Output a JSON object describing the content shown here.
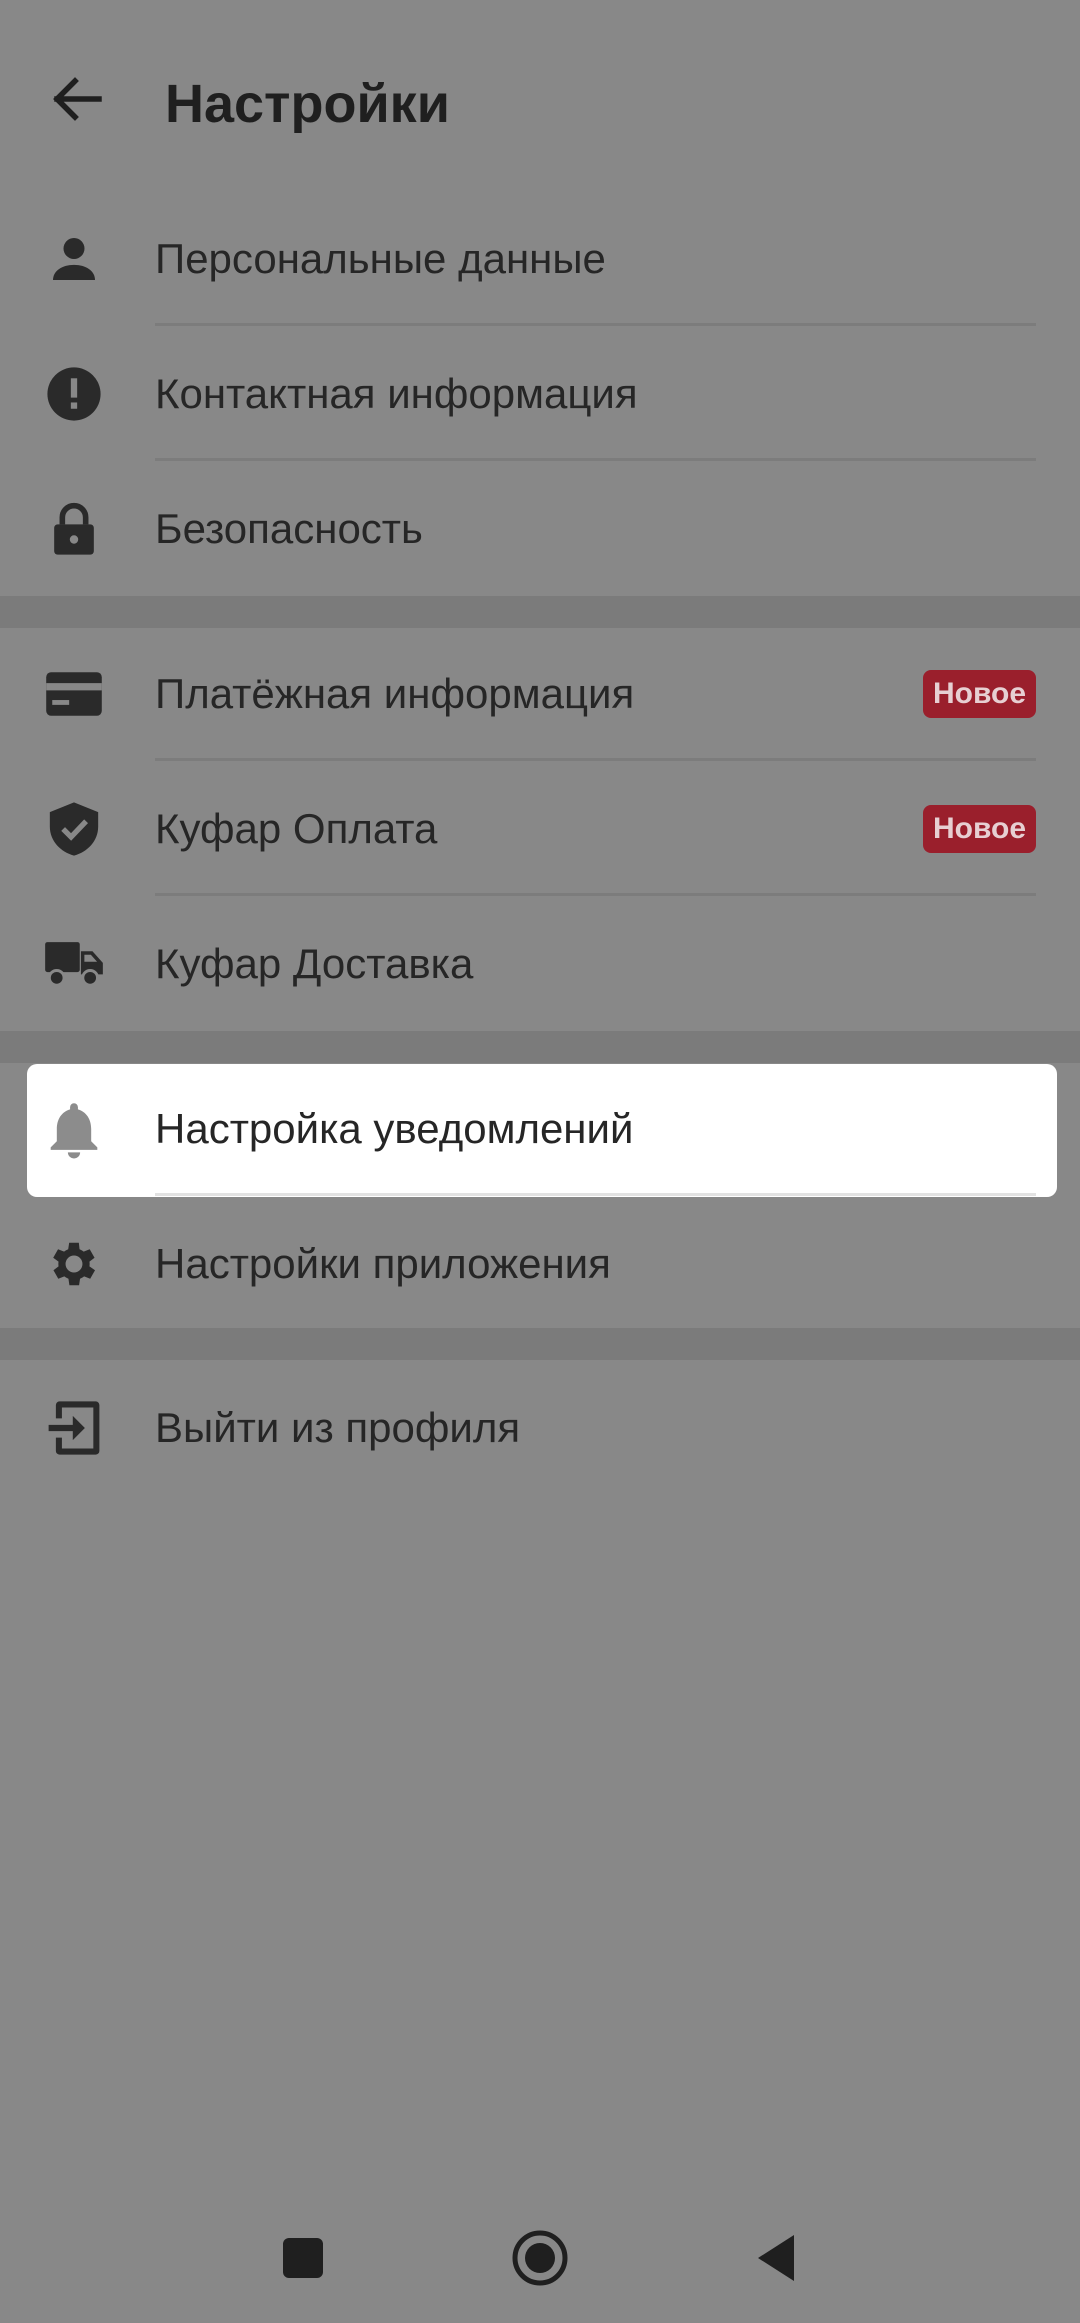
{
  "header": {
    "title": "Настройки",
    "back_icon": "arrow-left-icon"
  },
  "groups": [
    {
      "items": [
        {
          "label": "Персональные данные",
          "icon": "person-icon"
        },
        {
          "label": "Контактная информация",
          "icon": "exclamation-circle-icon"
        },
        {
          "label": "Безопасность",
          "icon": "lock-icon"
        }
      ]
    },
    {
      "items": [
        {
          "label": "Платёжная информация",
          "icon": "credit-card-icon",
          "badge": "Новое"
        },
        {
          "label": "Куфар Оплата",
          "icon": "shield-check-icon",
          "badge": "Новое"
        },
        {
          "label": "Куфар Доставка",
          "icon": "truck-icon"
        }
      ]
    },
    {
      "items": [
        {
          "label": "Настройка уведомлений",
          "icon": "bell-icon",
          "highlighted": true
        },
        {
          "label": "Настройки приложения",
          "icon": "gear-icon"
        }
      ]
    },
    {
      "items": [
        {
          "label": "Выйти из профиля",
          "icon": "logout-icon"
        }
      ]
    }
  ],
  "colors": {
    "overlay_background": "#888888",
    "badge_background": "#9a1f2c",
    "highlight_background": "#ffffff"
  },
  "navbar": {
    "recents_icon": "square-icon",
    "home_icon": "circle-icon",
    "back_icon": "triangle-back-icon"
  }
}
